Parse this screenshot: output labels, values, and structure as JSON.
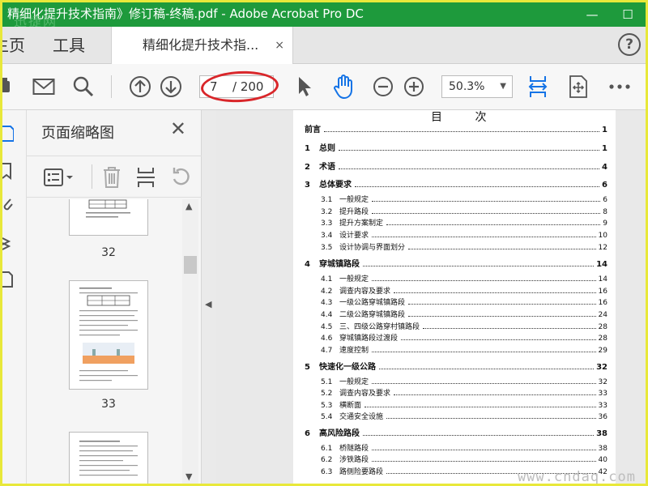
{
  "window": {
    "title": "精细化提升技术指南》修订稿-终稿.pdf - Adobe Acrobat Pro DC",
    "watermark": "迅捷网",
    "minimize": "—",
    "maximize": "☐"
  },
  "tabs": {
    "home": "主页",
    "tools": "工具",
    "document": "精细化提升技术指...",
    "close": "×",
    "help": "?"
  },
  "toolbar": {
    "current_page": "7",
    "total_pages": "/ 200",
    "zoom": "50.3%"
  },
  "thumb_panel": {
    "title": "页面缩略图",
    "thumbnails": [
      {
        "label": "32"
      },
      {
        "label": "33"
      },
      {
        "label": ""
      }
    ]
  },
  "document": {
    "toc_heading": "目 次",
    "entries": [
      {
        "level": 1,
        "num": "",
        "text": "前言",
        "page": "1"
      },
      {
        "level": 1,
        "num": "1",
        "text": "总则",
        "page": "1"
      },
      {
        "level": 1,
        "num": "2",
        "text": "术语",
        "page": "4"
      },
      {
        "level": 1,
        "num": "3",
        "text": "总体要求",
        "page": "6"
      },
      {
        "level": 2,
        "num": "3.1",
        "text": "一般规定",
        "page": "6"
      },
      {
        "level": 2,
        "num": "3.2",
        "text": "提升路段",
        "page": "8"
      },
      {
        "level": 2,
        "num": "3.3",
        "text": "提升方案制定",
        "page": "9"
      },
      {
        "level": 2,
        "num": "3.4",
        "text": "设计要求",
        "page": "10"
      },
      {
        "level": 2,
        "num": "3.5",
        "text": "设计协调与界面划分",
        "page": "12"
      },
      {
        "level": 1,
        "num": "4",
        "text": "穿城镇路段",
        "page": "14"
      },
      {
        "level": 2,
        "num": "4.1",
        "text": "一般规定",
        "page": "14"
      },
      {
        "level": 2,
        "num": "4.2",
        "text": "调查内容及要求",
        "page": "16"
      },
      {
        "level": 2,
        "num": "4.3",
        "text": "一级公路穿城镇路段",
        "page": "16"
      },
      {
        "level": 2,
        "num": "4.4",
        "text": "二级公路穿城镇路段",
        "page": "24"
      },
      {
        "level": 2,
        "num": "4.5",
        "text": "三、四级公路穿村镇路段",
        "page": "28"
      },
      {
        "level": 2,
        "num": "4.6",
        "text": "穿城镇路段过渡段",
        "page": "28"
      },
      {
        "level": 2,
        "num": "4.7",
        "text": "速度控制",
        "page": "29"
      },
      {
        "level": 1,
        "num": "5",
        "text": "快速化一级公路",
        "page": "32"
      },
      {
        "level": 2,
        "num": "5.1",
        "text": "一般规定",
        "page": "32"
      },
      {
        "level": 2,
        "num": "5.2",
        "text": "调查内容及要求",
        "page": "33"
      },
      {
        "level": 2,
        "num": "5.3",
        "text": "横断面",
        "page": "33"
      },
      {
        "level": 2,
        "num": "5.4",
        "text": "交通安全设施",
        "page": "36"
      },
      {
        "level": 1,
        "num": "6",
        "text": "高风险路段",
        "page": "38"
      },
      {
        "level": 2,
        "num": "6.1",
        "text": "桥隧路段",
        "page": "38"
      },
      {
        "level": 2,
        "num": "6.2",
        "text": "涉铁路段",
        "page": "40"
      },
      {
        "level": 2,
        "num": "6.3",
        "text": "路侧险要路段",
        "page": "42"
      }
    ]
  },
  "watermark_bottom": "www.cndaq.com",
  "colors": {
    "titlebar": "#1e9a3c",
    "accent_blue": "#1473e6",
    "annotation_red": "#d9262a"
  }
}
